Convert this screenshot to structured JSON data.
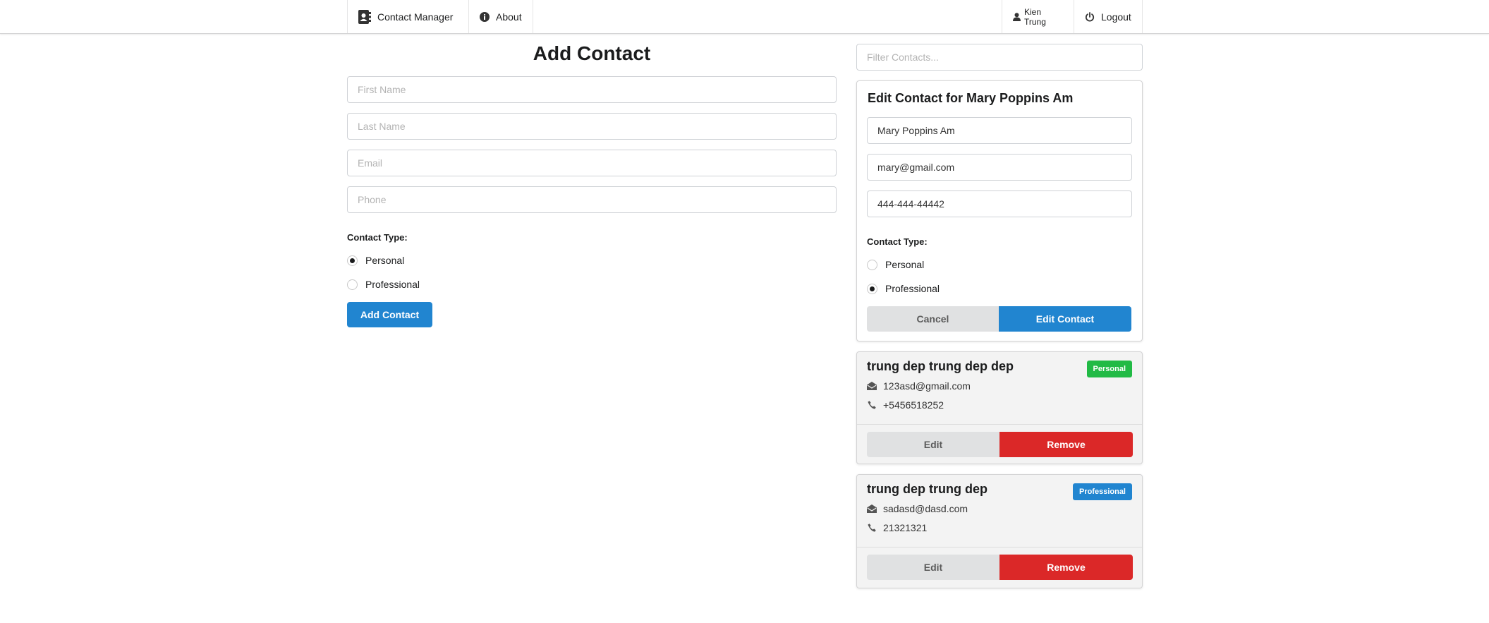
{
  "nav": {
    "brand": "Contact Manager",
    "about": "About",
    "user": "Kien Trung",
    "logout": "Logout"
  },
  "add_form": {
    "title": "Add Contact",
    "first_name_placeholder": "First Name",
    "last_name_placeholder": "Last Name",
    "email_placeholder": "Email",
    "phone_placeholder": "Phone",
    "contact_type_label": "Contact Type:",
    "type_options": [
      "Personal",
      "Professional"
    ],
    "selected_type": "Personal",
    "submit_label": "Add Contact"
  },
  "filter": {
    "placeholder": "Filter Contacts..."
  },
  "edit_form": {
    "title": "Edit Contact for Mary Poppins Am",
    "name_value": "Mary Poppins Am",
    "email_value": "mary@gmail.com",
    "phone_value": "444-444-44442",
    "contact_type_label": "Contact Type:",
    "type_options": [
      "Personal",
      "Professional"
    ],
    "selected_type": "Professional",
    "cancel_label": "Cancel",
    "submit_label": "Edit Contact"
  },
  "contacts": [
    {
      "name": "trung dep trung dep dep",
      "type": "Personal",
      "email": "123asd@gmail.com",
      "phone": "+5456518252",
      "edit_label": "Edit",
      "remove_label": "Remove"
    },
    {
      "name": "trung dep trung dep",
      "type": "Professional",
      "email": "sadasd@dasd.com",
      "phone": "21321321",
      "edit_label": "Edit",
      "remove_label": "Remove"
    }
  ],
  "colors": {
    "primary": "#2185d0",
    "danger": "#db2828",
    "personal_badge": "#21ba45",
    "professional_badge": "#2185d0",
    "button_grey": "#e0e1e2"
  },
  "icons": {
    "brand": "address-book-icon",
    "about": "info-circle-icon",
    "user": "user-icon",
    "logout": "power-icon",
    "email": "envelope-icon",
    "phone": "phone-icon"
  }
}
